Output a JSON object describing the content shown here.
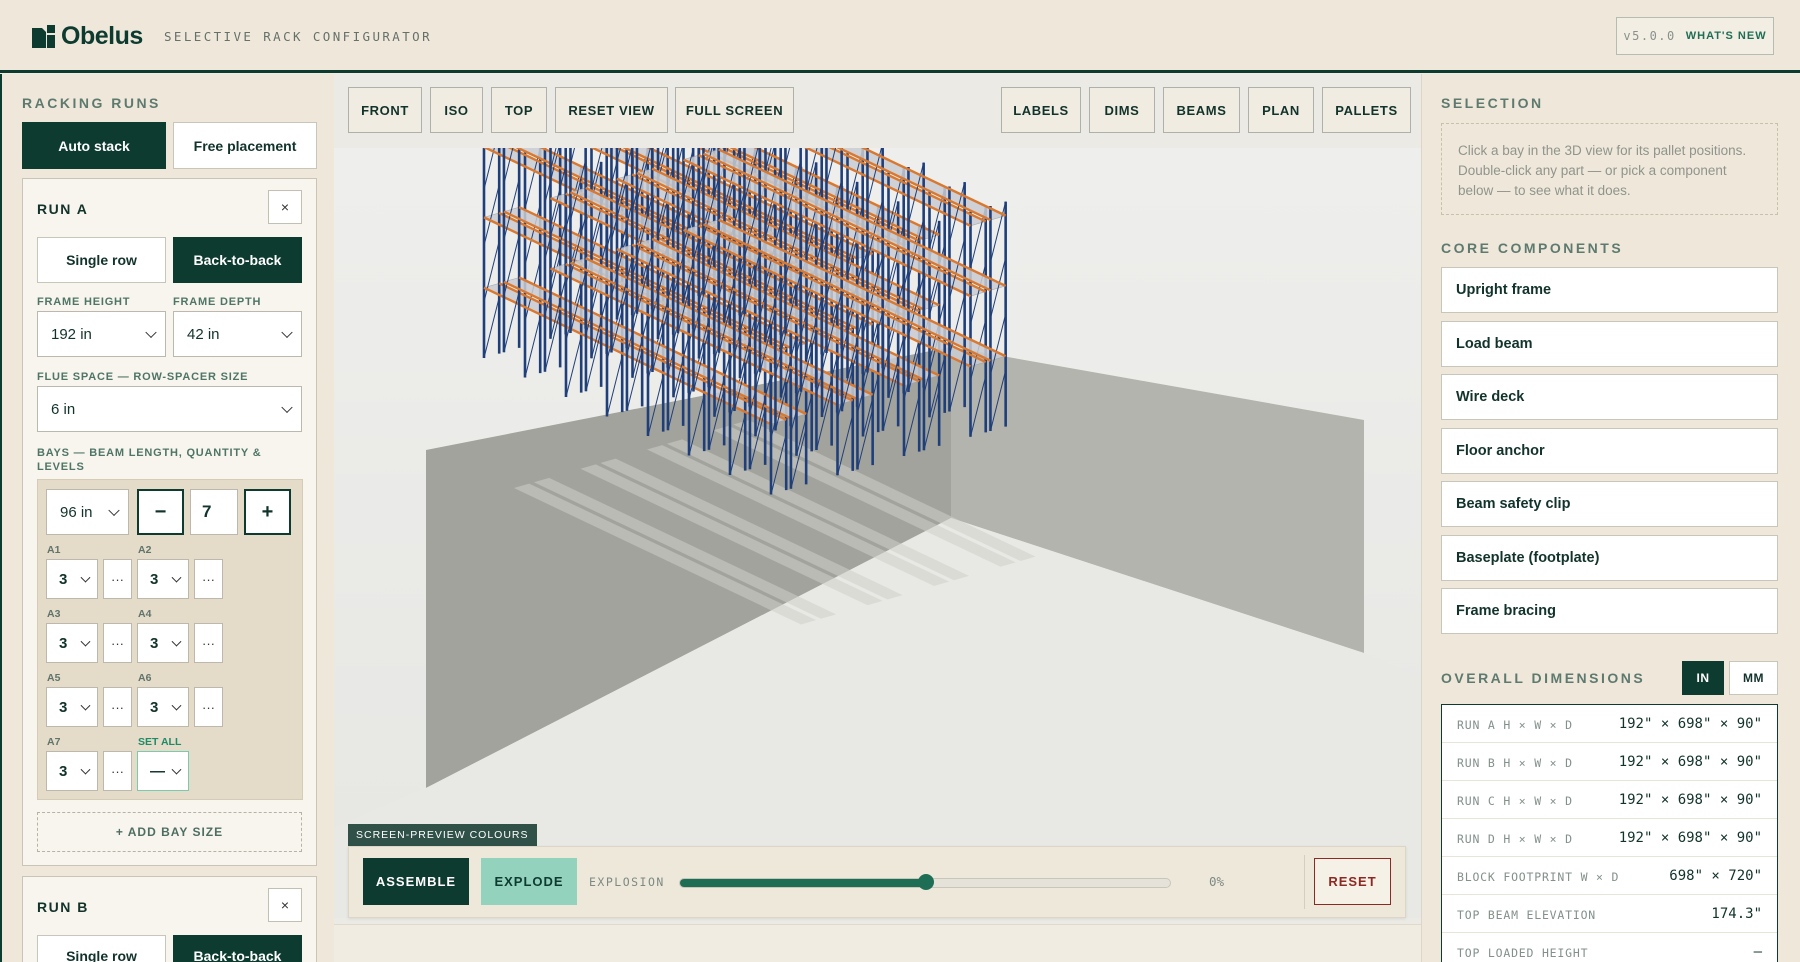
{
  "header": {
    "brand": "Obelus",
    "subtitle": "SELECTIVE RACK CONFIGURATOR",
    "version": "v5.0.0",
    "whats_new": "WHAT'S NEW"
  },
  "left": {
    "section_title": "RACKING RUNS",
    "placement_modes": [
      "Auto stack",
      "Free placement"
    ],
    "active_mode": "Auto stack",
    "run_a": {
      "title": "RUN A",
      "close": "×",
      "layout_options": [
        "Single row",
        "Back-to-back"
      ],
      "active_layout": "Back-to-back",
      "frame_height_label": "FRAME HEIGHT",
      "frame_height_value": "192 in",
      "frame_depth_label": "FRAME DEPTH",
      "frame_depth_value": "42 in",
      "flue_label": "FLUE SPACE — ROW-SPACER SIZE",
      "flue_value": "6 in",
      "bays_label": "BAYS — BEAM LENGTH, QUANTITY & LEVELS",
      "beam_length": "96 in",
      "minus": "−",
      "quantity": "7",
      "plus": "+",
      "bays": [
        {
          "label": "A1",
          "levels": "3",
          "more": "···"
        },
        {
          "label": "A2",
          "levels": "3",
          "more": "···"
        },
        {
          "label": "A3",
          "levels": "3",
          "more": "···"
        },
        {
          "label": "A4",
          "levels": "3",
          "more": "···"
        },
        {
          "label": "A5",
          "levels": "3",
          "more": "···"
        },
        {
          "label": "A6",
          "levels": "3",
          "more": "···"
        },
        {
          "label": "A7",
          "levels": "3",
          "more": "···"
        }
      ],
      "set_all_label": "SET ALL",
      "set_all_value": "—",
      "add_bay": "+ ADD BAY SIZE"
    },
    "run_b": {
      "title": "RUN B",
      "close": "×",
      "layout_options": [
        "Single row",
        "Back-to-back"
      ]
    }
  },
  "toolbar": {
    "view_buttons": [
      "FRONT",
      "ISO",
      "TOP",
      "RESET VIEW",
      "FULL SCREEN"
    ],
    "layer_buttons": [
      "LABELS",
      "DIMS",
      "BEAMS",
      "PLAN",
      "PALLETS"
    ]
  },
  "preview": {
    "tag": "SCREEN-PREVIEW COLOURS",
    "assemble": "ASSEMBLE",
    "explode": "EXPLODE",
    "explosion_label": "EXPLOSION",
    "explosion_percent": "0%",
    "slider_fraction": 0.5,
    "reset": "RESET"
  },
  "right": {
    "selection_title": "SELECTION",
    "selection_hint": "Click a bay in the 3D view for its pallet positions. Double-click any part — or pick a component below — to see what it does.",
    "core_title": "CORE COMPONENTS",
    "components": [
      "Upright frame",
      "Load beam",
      "Wire deck",
      "Floor anchor",
      "Beam safety clip",
      "Baseplate (footplate)",
      "Frame bracing"
    ],
    "dims_title": "OVERALL DIMENSIONS",
    "units": [
      "IN",
      "MM"
    ],
    "active_unit": "IN",
    "dims": [
      {
        "label": "RUN A H × W × D",
        "value": "192\" × 698\" × 90\""
      },
      {
        "label": "RUN B H × W × D",
        "value": "192\" × 698\" × 90\""
      },
      {
        "label": "RUN C H × W × D",
        "value": "192\" × 698\" × 90\""
      },
      {
        "label": "RUN D H × W × D",
        "value": "192\" × 698\" × 90\""
      },
      {
        "label": "BLOCK FOOTPRINT W × D",
        "value": "698\" × 720\""
      },
      {
        "label": "TOP BEAM ELEVATION",
        "value": "174.3\""
      },
      {
        "label": "TOP LOADED HEIGHT",
        "value": "–"
      }
    ]
  },
  "colors": {
    "brand_dark": "#0d3b30",
    "accent_green": "#1e6e55",
    "explode_mint": "#93d3bd",
    "upright_blue": "#1f3f7a",
    "beam_orange": "#d9782e",
    "reset_red": "#8b2a22"
  }
}
